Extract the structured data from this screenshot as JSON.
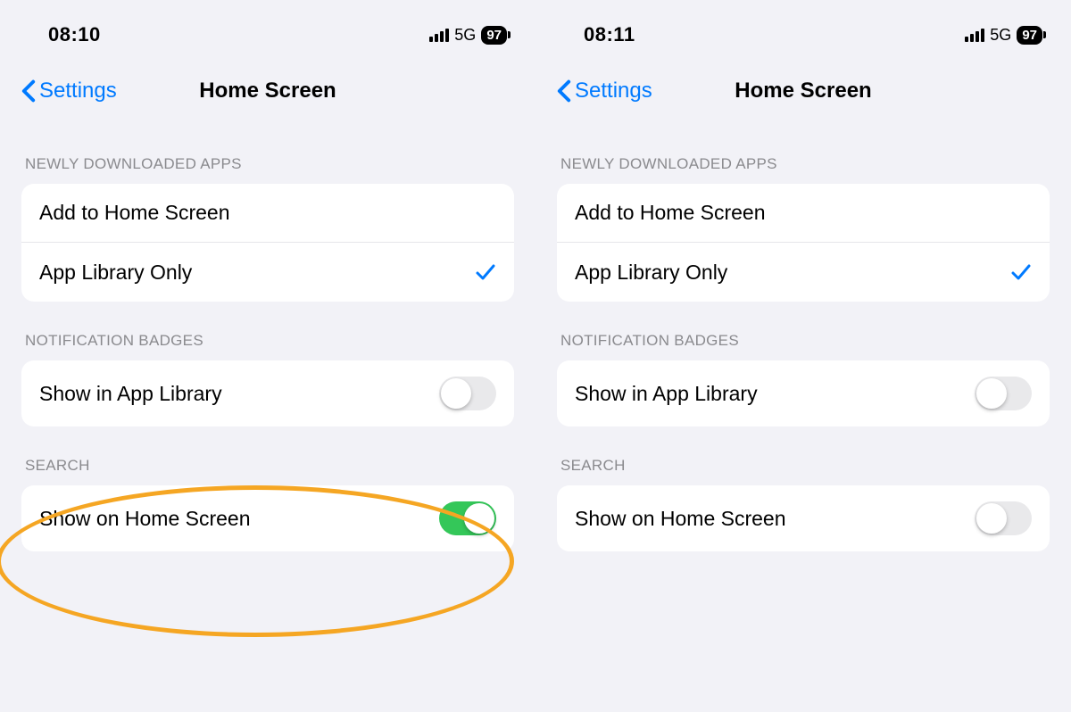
{
  "left": {
    "status": {
      "time": "08:10",
      "network": "5G",
      "battery": "97"
    },
    "nav": {
      "back": "Settings",
      "title": "Home Screen"
    },
    "sections": {
      "newApps": {
        "header": "NEWLY DOWNLOADED APPS",
        "items": [
          {
            "label": "Add to Home Screen",
            "checked": false
          },
          {
            "label": "App Library Only",
            "checked": true
          }
        ]
      },
      "badges": {
        "header": "NOTIFICATION BADGES",
        "items": [
          {
            "label": "Show in App Library",
            "toggle": false
          }
        ]
      },
      "search": {
        "header": "SEARCH",
        "items": [
          {
            "label": "Show on Home Screen",
            "toggle": true
          }
        ]
      }
    },
    "annotation": {
      "highlight_search_row": true
    }
  },
  "right": {
    "status": {
      "time": "08:11",
      "network": "5G",
      "battery": "97"
    },
    "nav": {
      "back": "Settings",
      "title": "Home Screen"
    },
    "sections": {
      "newApps": {
        "header": "NEWLY DOWNLOADED APPS",
        "items": [
          {
            "label": "Add to Home Screen",
            "checked": false
          },
          {
            "label": "App Library Only",
            "checked": true
          }
        ]
      },
      "badges": {
        "header": "NOTIFICATION BADGES",
        "items": [
          {
            "label": "Show in App Library",
            "toggle": false
          }
        ]
      },
      "search": {
        "header": "SEARCH",
        "items": [
          {
            "label": "Show on Home Screen",
            "toggle": false
          }
        ]
      }
    }
  }
}
